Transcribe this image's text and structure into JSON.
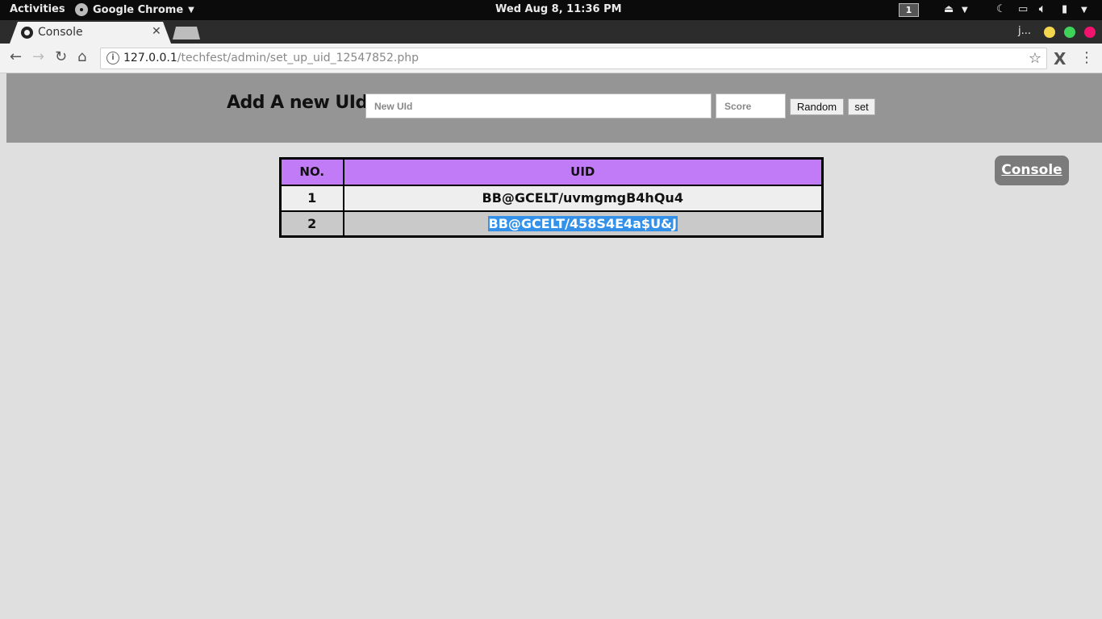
{
  "system_bar": {
    "activities": "Activities",
    "app_name": "Google Chrome",
    "clock": "Wed Aug  8, 11:36 PM",
    "workspace": "1"
  },
  "browser": {
    "tab_title": "Console",
    "window_user": "j...",
    "url_host": "127.0.0.1",
    "url_path": "/techfest/admin/set_up_uid_12547852.php",
    "window_controls_colors": {
      "minimize": "#f5d64f",
      "maximize": "#3ed45a",
      "close": "#f2136d"
    }
  },
  "add_form": {
    "label": "Add A new UId :-",
    "uid_placeholder": "New UId",
    "uid_value": "",
    "score_placeholder": "Score",
    "score_value": "",
    "random_label": "Random",
    "set_label": "set"
  },
  "uid_table": {
    "headers": [
      "NO.",
      "UID"
    ],
    "header_color": "#c17bf7",
    "rows": [
      {
        "no": "1",
        "uid": "BB@GCELT/uvmgmgB4hQu4"
      },
      {
        "no": "2",
        "uid": "BB@GCELT/458S4E4a$U&J",
        "selected": true
      }
    ]
  },
  "console_button": {
    "label": "Console"
  }
}
